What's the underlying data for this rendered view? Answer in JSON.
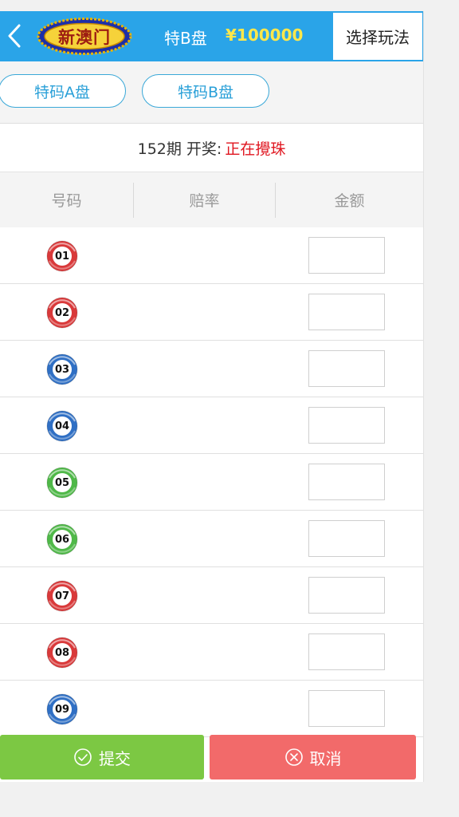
{
  "header": {
    "logo_text": "新澳门",
    "plate_label": "特B盘",
    "balance": "¥100000",
    "select_play_label": "选择玩法"
  },
  "tabs": [
    {
      "label": "特码A盘"
    },
    {
      "label": "特码B盘"
    }
  ],
  "draw": {
    "prefix": "152期 开奖:",
    "status": "正在攪珠"
  },
  "table": {
    "columns": [
      "号码",
      "赔率",
      "金额"
    ],
    "rows": [
      {
        "number": "01",
        "color": "red"
      },
      {
        "number": "02",
        "color": "red"
      },
      {
        "number": "03",
        "color": "blue"
      },
      {
        "number": "04",
        "color": "blue"
      },
      {
        "number": "05",
        "color": "green"
      },
      {
        "number": "06",
        "color": "green"
      },
      {
        "number": "07",
        "color": "red"
      },
      {
        "number": "08",
        "color": "red"
      },
      {
        "number": "09",
        "color": "blue"
      }
    ]
  },
  "actions": {
    "submit_label": "提交",
    "cancel_label": "取消"
  },
  "colors": {
    "header_bg": "#2aa4e8",
    "ball_red": "#d9393a",
    "ball_blue": "#2f6fc4",
    "ball_green": "#4fb848",
    "submit_bg": "#7cc843",
    "cancel_bg": "#f26a6a",
    "status_red": "#e0151f"
  }
}
